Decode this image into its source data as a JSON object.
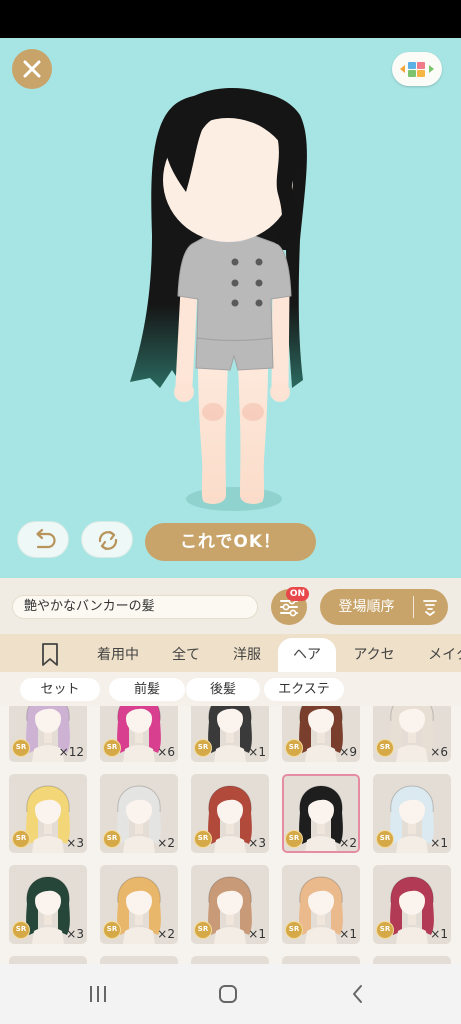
{
  "colors": {
    "preview_bg": "#a6e5e3",
    "accent": "#c8a46a",
    "selected_border": "#e68ca2",
    "badge_red": "#e9484b",
    "rarity_badge": "#d6a948"
  },
  "preview": {
    "close_icon": "close-icon",
    "layout_icon": "layout-toggle-icon",
    "undo_icon": "undo-icon",
    "rotate_icon": "rotate-icon",
    "confirm_label": "これでOK！"
  },
  "toolbar": {
    "search_value": "艶やかなバンカーの髪",
    "filter_icon": "filter-sliders-icon",
    "filter_badge": "ON",
    "sort_label": "登場順序",
    "sort_icon": "sort-order-icon"
  },
  "tabs": [
    {
      "icon": "bookmark-icon"
    },
    {
      "label": "着用中"
    },
    {
      "label": "全て"
    },
    {
      "label": "洋服"
    },
    {
      "label": "ヘア",
      "selected": true
    },
    {
      "label": "アクセ"
    },
    {
      "label": "メイク"
    }
  ],
  "sub_tabs": [
    {
      "label": "セット"
    },
    {
      "label": "前髪"
    },
    {
      "label": "後髪"
    },
    {
      "label": "エクステ"
    }
  ],
  "items": [
    {
      "rarity": "SR",
      "count": "×12",
      "hair_color": "#cdb2d4"
    },
    {
      "rarity": "SR",
      "count": "×6",
      "hair_color": "#d8408f"
    },
    {
      "rarity": "SR",
      "count": "×1",
      "hair_color": "#3a3a3a"
    },
    {
      "rarity": "SR",
      "count": "×9",
      "hair_color": "#7a3f2c"
    },
    {
      "rarity": "SR",
      "count": "×6",
      "hair_color": "#e8dfd4"
    },
    {
      "rarity": "SR",
      "count": "×3",
      "hair_color": "#f2d678"
    },
    {
      "rarity": "SR",
      "count": "×2",
      "hair_color": "#e4e4e2"
    },
    {
      "rarity": "SR",
      "count": "×3",
      "hair_color": "#b24a3c"
    },
    {
      "rarity": "SR",
      "count": "×2",
      "hair_color": "#1e1e1e",
      "selected": true
    },
    {
      "rarity": "SR",
      "count": "×1",
      "hair_color": "#dbe9f0"
    },
    {
      "rarity": "SR",
      "count": "×3",
      "hair_color": "#27463a"
    },
    {
      "rarity": "SR",
      "count": "×2",
      "hair_color": "#e9b76c"
    },
    {
      "rarity": "SR",
      "count": "×1",
      "hair_color": "#c99a78"
    },
    {
      "rarity": "SR",
      "count": "×1",
      "hair_color": "#eab98c"
    },
    {
      "rarity": "SR",
      "count": "×1",
      "hair_color": "#b33a54"
    }
  ],
  "nav": {
    "recents_icon": "recent-apps-icon",
    "home_icon": "home-icon",
    "back_icon": "back-icon"
  }
}
